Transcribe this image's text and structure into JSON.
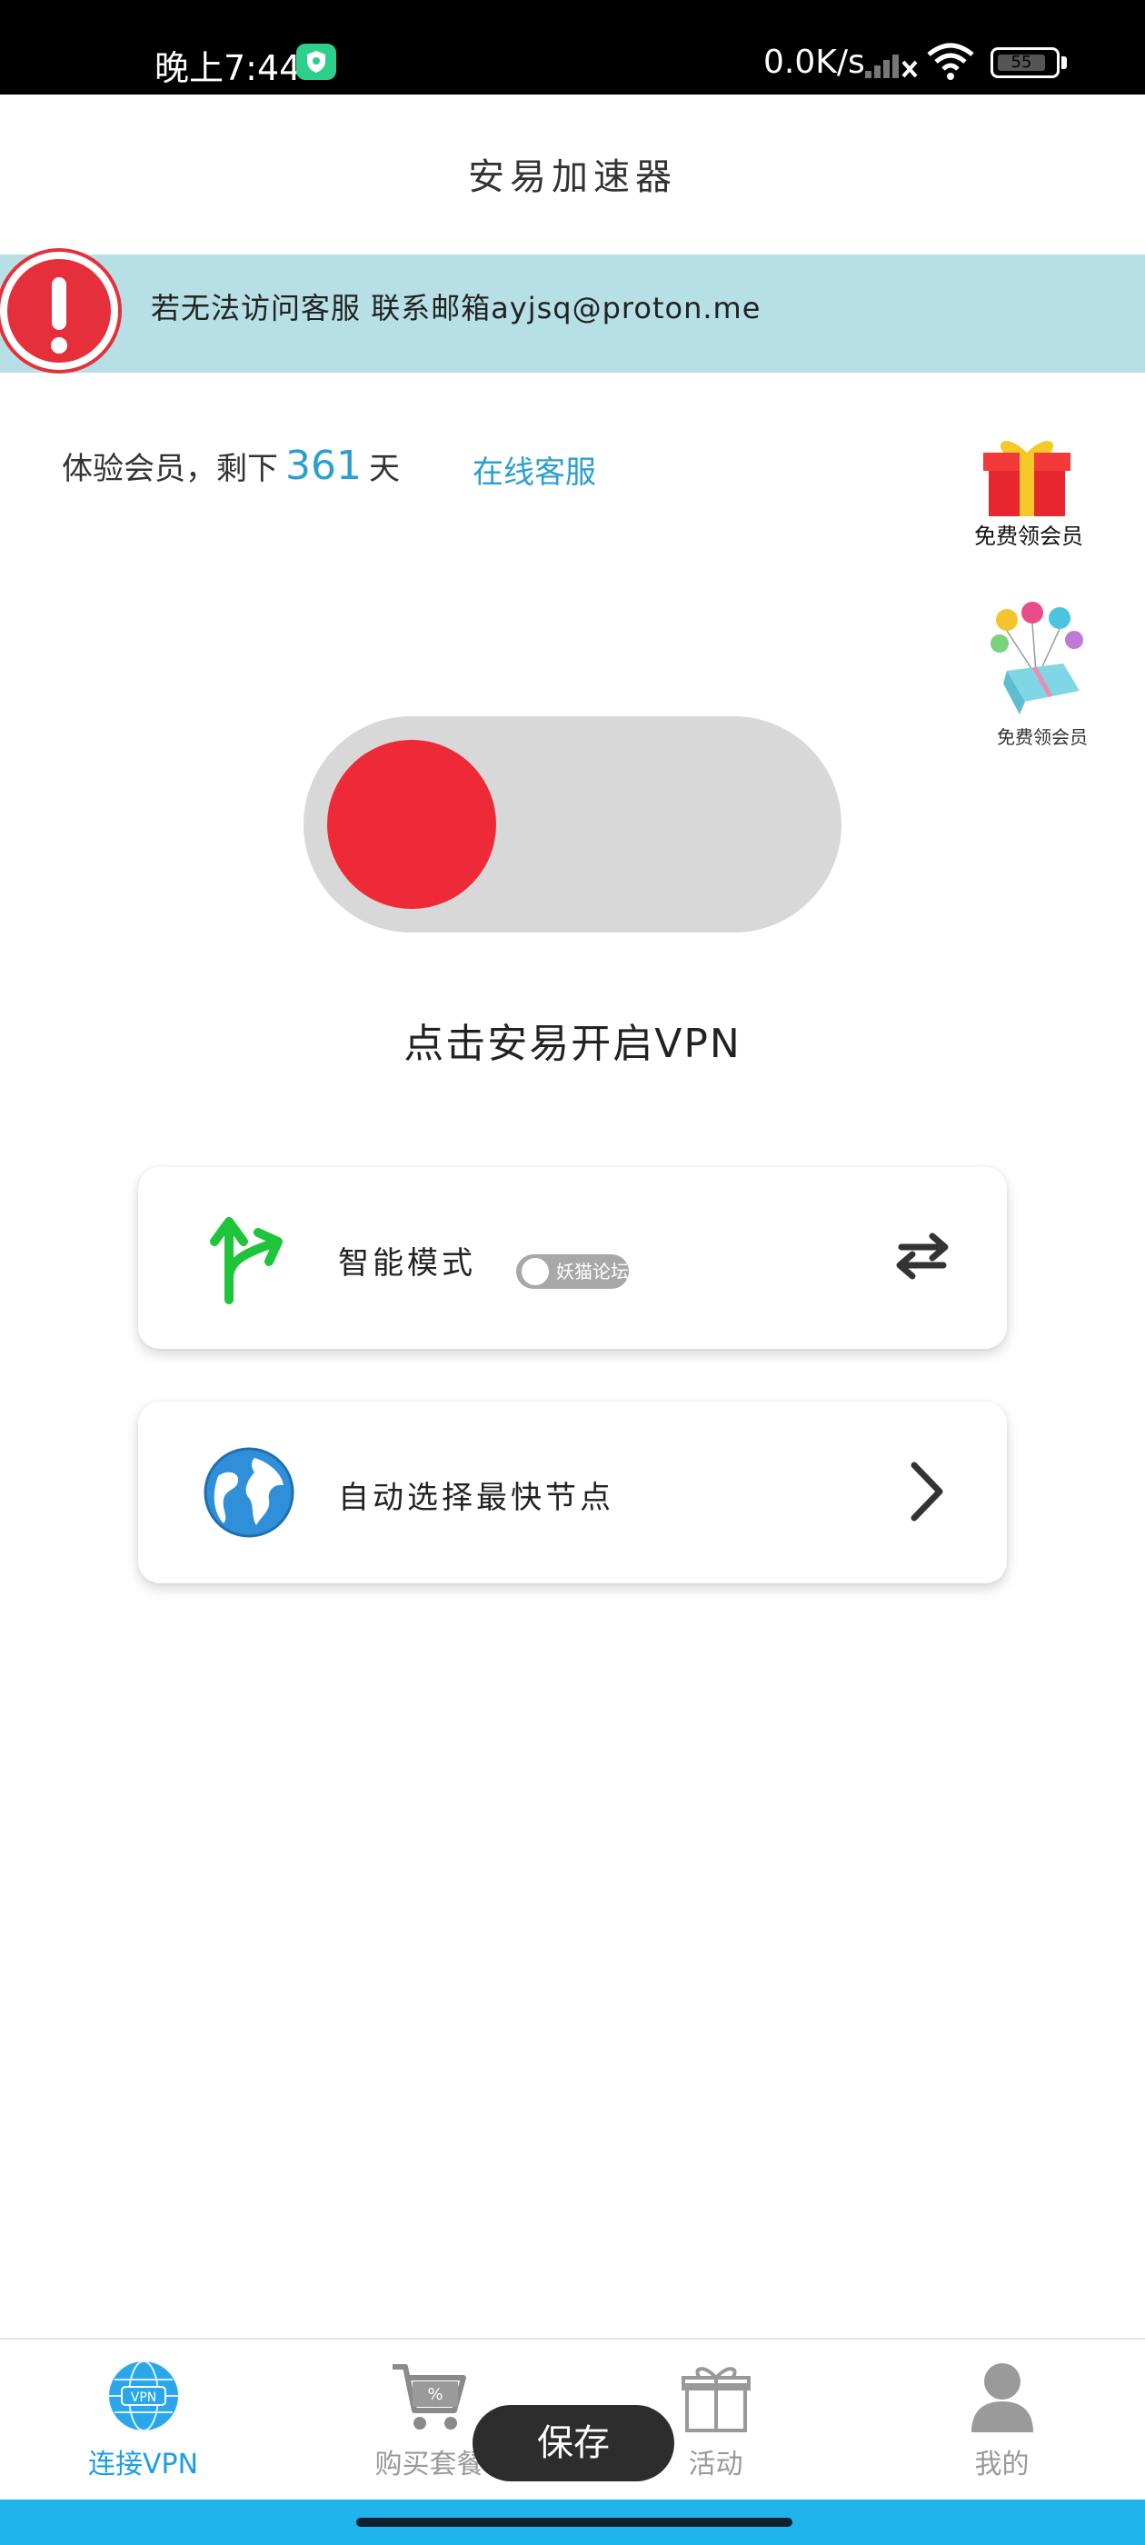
{
  "status_bar": {
    "time": "晚上7:44",
    "net_speed": "0.0K/s",
    "battery_level": "55"
  },
  "header": {
    "title": "安易加速器"
  },
  "notice": {
    "text": "若无法访问客服 联系邮箱ayjsq@proton.me"
  },
  "membership": {
    "prefix": "体验会员，剩下",
    "days": "361",
    "suffix": "天",
    "service_link": "在线客服"
  },
  "promos": [
    {
      "label": "免费领会员",
      "icon": "gift-box-icon"
    },
    {
      "label": "免费领会员",
      "icon": "balloon-gift-icon"
    }
  ],
  "vpn_toggle": {
    "state": "off",
    "hint": "点击安易开启VPN",
    "knob_color": "#ef2a38"
  },
  "cards": {
    "mode": {
      "label": "智能模式",
      "icon": "split-arrows-icon",
      "action_icon": "swap-arrows-icon"
    },
    "node": {
      "label": "自动选择最快节点",
      "icon": "globe-icon",
      "action_icon": "chevron-right-icon"
    }
  },
  "watermark": {
    "text": "妖猫论坛"
  },
  "bottom_nav": {
    "items": [
      {
        "label": "连接VPN",
        "active": true,
        "icon": "vpn-globe-icon"
      },
      {
        "label": "购买套餐",
        "active": false,
        "icon": "cart-icon"
      },
      {
        "label": "活动",
        "active": false,
        "icon": "gift-icon"
      },
      {
        "label": "我的",
        "active": false,
        "icon": "user-icon"
      }
    ]
  },
  "toast": {
    "text": "保存"
  },
  "colors": {
    "accent": "#1b9ee6",
    "notice_bg": "#b7dfe6",
    "alert_red": "#e5303b"
  }
}
